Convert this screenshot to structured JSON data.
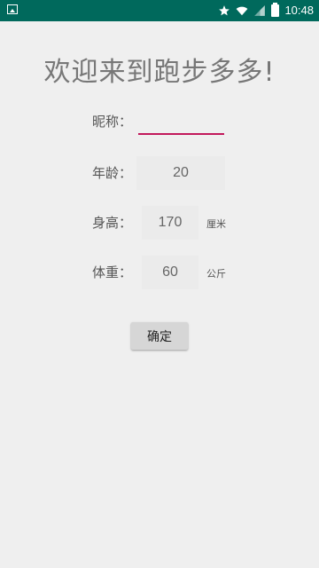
{
  "status_bar": {
    "time": "10:48",
    "icons": [
      "image-notification-icon",
      "star-icon",
      "wifi-icon",
      "signal-icon",
      "battery-charging-icon"
    ],
    "background_color": "#00695c"
  },
  "page": {
    "title": "欢迎来到跑步多多!"
  },
  "form": {
    "nickname": {
      "label": "昵称：",
      "value": ""
    },
    "age": {
      "label": "年龄：",
      "value": "20"
    },
    "height": {
      "label": "身高：",
      "value": "170",
      "unit": "厘米"
    },
    "weight": {
      "label": "体重：",
      "value": "60",
      "unit": "公斤"
    },
    "confirm_label": "确定",
    "accent_color": "#c2185b"
  }
}
